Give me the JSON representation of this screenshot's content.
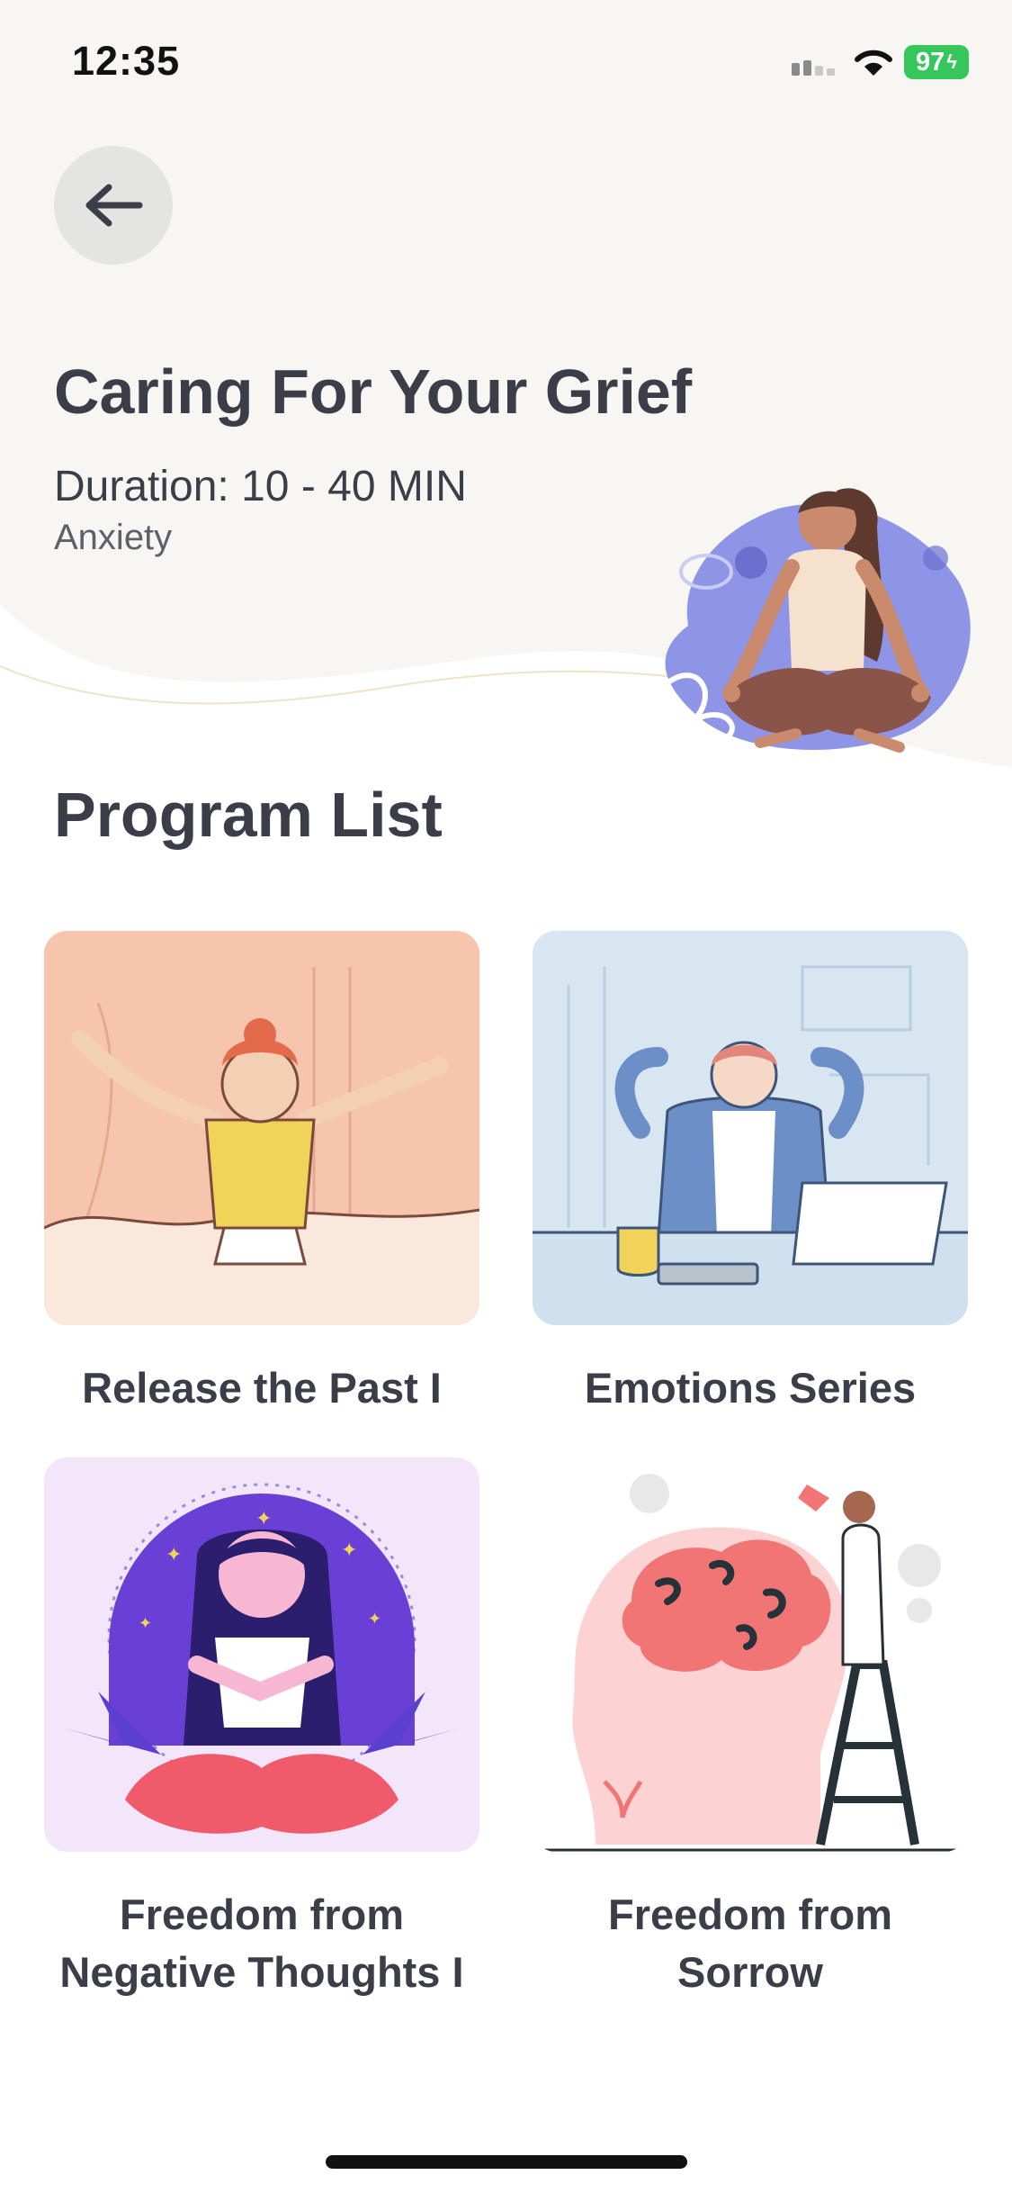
{
  "status_bar": {
    "time": "12:35",
    "battery": "97"
  },
  "header": {
    "back_icon": "arrow-left-icon",
    "title": "Caring For Your Grief",
    "duration": "Duration: 10 - 40 MIN",
    "category": "Anxiety",
    "background_color": "#f7f6f3",
    "hero_icon": "meditation-woman-illustration"
  },
  "section": {
    "title": "Program List"
  },
  "programs": [
    {
      "label": "Release the Past I",
      "thumb_color": "#f7c4ae",
      "icon": "woman-stretching-illustration"
    },
    {
      "label": "Emotions Series",
      "thumb_color": "#d8e6f1",
      "icon": "man-relaxing-at-desk-illustration"
    },
    {
      "label": "Freedom from Negative Thoughts I",
      "thumb_color": "#f4e6fa",
      "icon": "woman-praying-illustration"
    },
    {
      "label": "Freedom from Sorrow",
      "thumb_color": "#ffffff",
      "icon": "watering-brain-illustration"
    }
  ],
  "colors": {
    "text_primary": "#3b3e48",
    "battery_green": "#36c75a"
  }
}
